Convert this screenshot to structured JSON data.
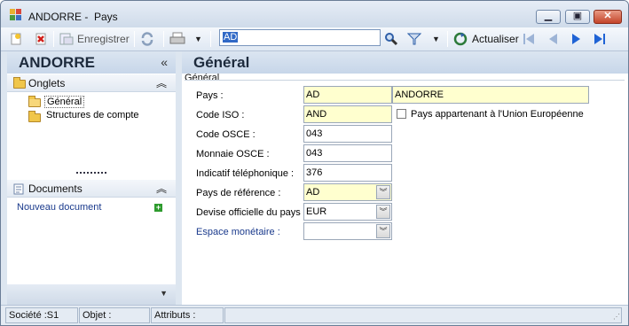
{
  "window": {
    "title": "ANDORRE -  Pays"
  },
  "toolbar": {
    "save_label": "Enregistrer",
    "search_value": "AD",
    "refresh_label": "Actualiser"
  },
  "left_panel": {
    "title": "ANDORRE",
    "tabs_section": "Onglets",
    "tabs": [
      "Général",
      "Structures de compte"
    ],
    "documents_section": "Documents",
    "new_document": "Nouveau document"
  },
  "main": {
    "title": "Général",
    "group": "Général",
    "fields": {
      "pays_label": "Pays :",
      "pays_code": "AD",
      "pays_name": "ANDORRE",
      "iso_label": "Code ISO :",
      "iso_value": "AND",
      "eu_label": "Pays appartenant à l'Union Européenne",
      "osce_label": "Code OSCE :",
      "osce_value": "043",
      "monnaie_label": "Monnaie OSCE :",
      "monnaie_value": "043",
      "indicatif_label": "Indicatif téléphonique :",
      "indicatif_value": "376",
      "ref_label": "Pays de référence :",
      "ref_value": "AD",
      "devise_label": "Devise officielle du pays :",
      "devise_value": "EUR",
      "espace_label": "Espace monétaire :",
      "espace_value": ""
    }
  },
  "status": {
    "societe": "Société :S1",
    "objet": "Objet :",
    "attributs": "Attributs :"
  },
  "colors": {
    "required_field": "#ffffcf",
    "header": "#c7d6e9",
    "link": "#1a3a8c"
  }
}
